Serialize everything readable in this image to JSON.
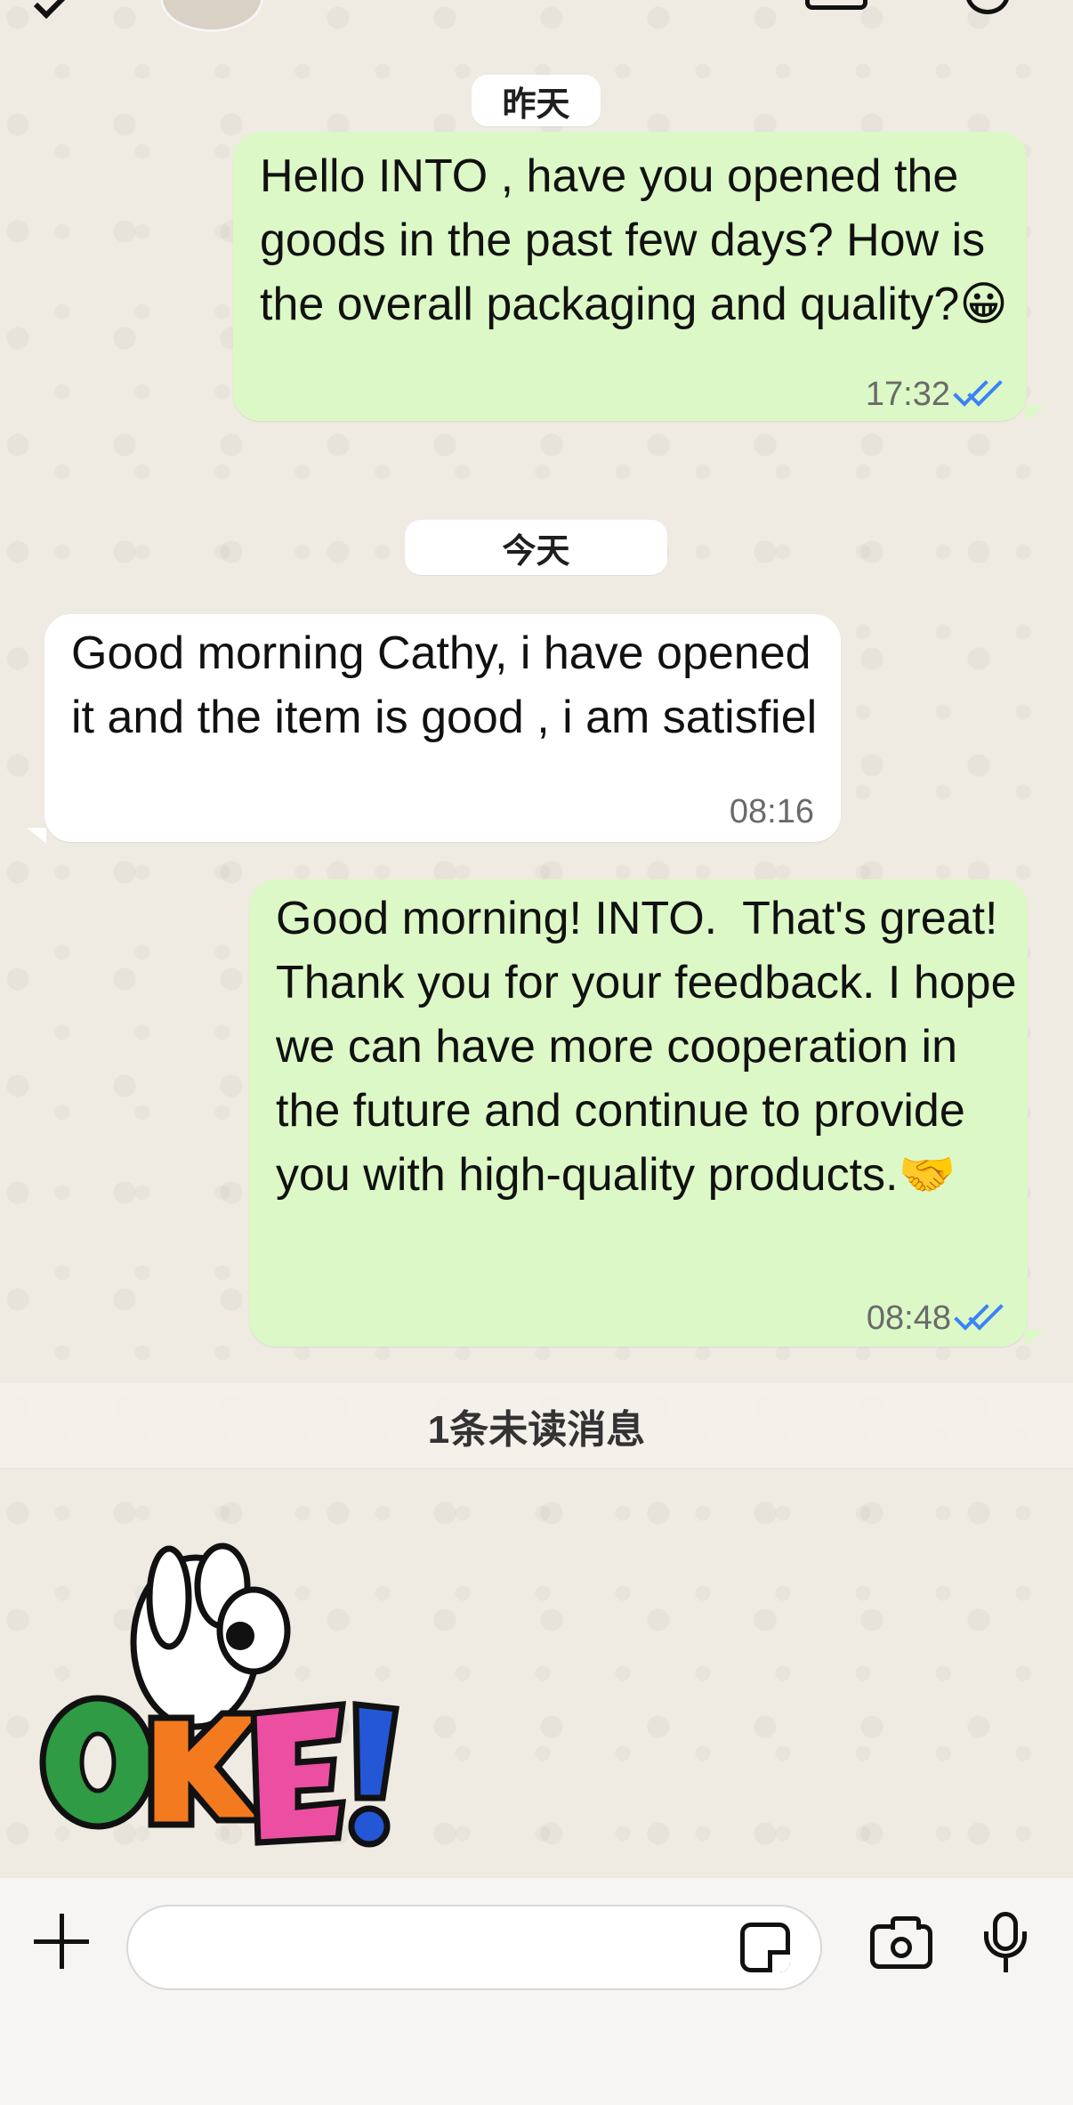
{
  "chat": {
    "date_separators": {
      "yesterday": "昨天",
      "today": "今天"
    },
    "messages": [
      {
        "direction": "outgoing",
        "text": "Hello INTO , have you opened the goods in the past few days? How is the overall packaging and quality?😀",
        "time": "17:32",
        "status": "read"
      },
      {
        "direction": "incoming",
        "text": "Good morning Cathy, i have opened it and the item is good , i am satisfiel",
        "time": "08:16"
      },
      {
        "direction": "outgoing",
        "text": "Good morning! INTO.  That's great! Thank you for your feedback. I hope we can have more cooperation in the future and continue to provide you with high-quality products.🤝",
        "time": "08:48",
        "status": "read"
      }
    ],
    "unread_banner": "1条未读消息",
    "sticker": {
      "type": "sticker",
      "text": "OKE!"
    }
  },
  "composer": {
    "input_value": "",
    "input_placeholder": "",
    "icons": {
      "plus": "plus-icon",
      "sticker": "sticker-icon",
      "camera": "camera-icon",
      "mic": "microphone-icon"
    }
  },
  "colors": {
    "background": "#efeae2",
    "outgoing_bubble": "#dcf8c6",
    "incoming_bubble": "#ffffff",
    "read_ticks": "#3b82f6"
  }
}
